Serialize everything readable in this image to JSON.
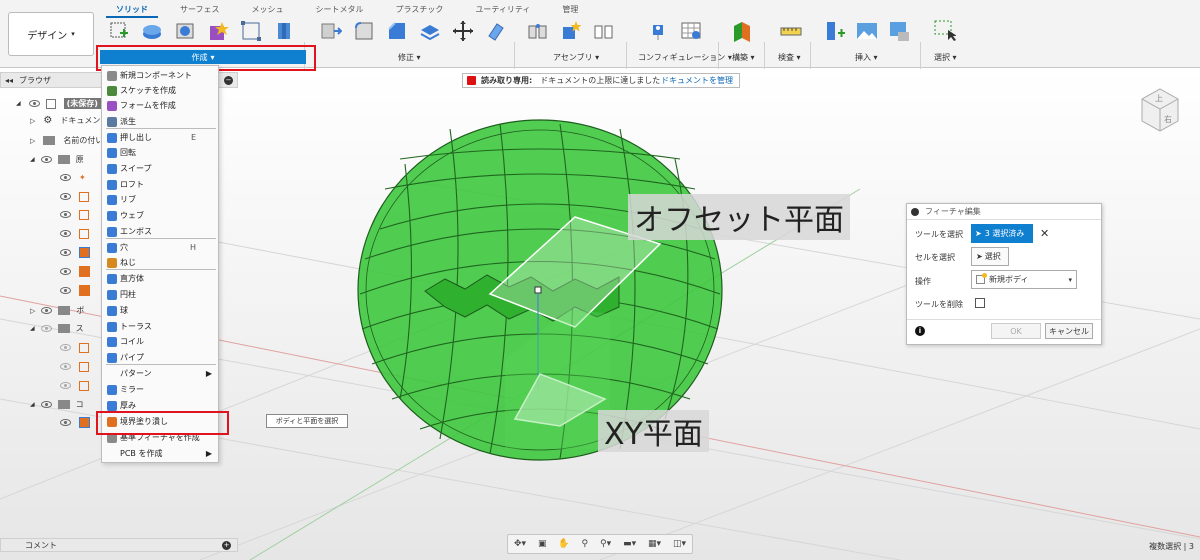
{
  "toolbar": {
    "design_label": "デザイン",
    "tabs": [
      "ソリッド",
      "サーフェス",
      "メッシュ",
      "シートメタル",
      "プラスチック",
      "ユーティリティ",
      "管理"
    ],
    "groups": {
      "create": "作成",
      "modify": "修正",
      "assemble": "アセンブリ",
      "configure": "コンフィギュレーション",
      "construct": "構築",
      "inspect": "検査",
      "insert": "挿入",
      "select": "選択"
    }
  },
  "browser": {
    "title": "ブラウザ",
    "items": [
      "(未保存)",
      "ドキュメントの設定",
      "名前の付いたビュー",
      "原",
      "ボ",
      "ス",
      "コ"
    ]
  },
  "readonly": {
    "label": "読み取り専用:",
    "message": "ドキュメントの上限に達しました",
    "manage_link": "ドキュメントを管理"
  },
  "create_menu": {
    "items": [
      {
        "label": "新規コンポーネント",
        "shortcut": "",
        "color": "#8a8a8a"
      },
      {
        "label": "スケッチを作成",
        "shortcut": "",
        "color": "#4a8a3a"
      },
      {
        "label": "フォームを作成",
        "shortcut": "",
        "color": "#9a4fc0"
      },
      {
        "label": "派生",
        "shortcut": "",
        "color": "#5a7aa0"
      },
      {
        "label": "押し出し",
        "shortcut": "E",
        "color": "#3a7bd5"
      },
      {
        "label": "回転",
        "shortcut": "",
        "color": "#3a7bd5"
      },
      {
        "label": "スイープ",
        "shortcut": "",
        "color": "#3a7bd5"
      },
      {
        "label": "ロフト",
        "shortcut": "",
        "color": "#3a7bd5"
      },
      {
        "label": "リブ",
        "shortcut": "",
        "color": "#3a7bd5"
      },
      {
        "label": "ウェブ",
        "shortcut": "",
        "color": "#3a7bd5"
      },
      {
        "label": "エンボス",
        "shortcut": "",
        "color": "#3a7bd5"
      },
      {
        "label": "穴",
        "shortcut": "H",
        "color": "#3a7bd5"
      },
      {
        "label": "ねじ",
        "shortcut": "",
        "color": "#d68a1e"
      },
      {
        "label": "直方体",
        "shortcut": "",
        "color": "#3a7bd5"
      },
      {
        "label": "円柱",
        "shortcut": "",
        "color": "#3a7bd5"
      },
      {
        "label": "球",
        "shortcut": "",
        "color": "#3a7bd5"
      },
      {
        "label": "トーラス",
        "shortcut": "",
        "color": "#3a7bd5"
      },
      {
        "label": "コイル",
        "shortcut": "",
        "color": "#3a7bd5"
      },
      {
        "label": "パイプ",
        "shortcut": "",
        "color": "#3a7bd5"
      },
      {
        "label": "パターン",
        "shortcut": "",
        "color": ""
      },
      {
        "label": "ミラー",
        "shortcut": "",
        "color": "#3a7bd5"
      },
      {
        "label": "厚み",
        "shortcut": "",
        "color": "#3a7bd5"
      },
      {
        "label": "境界塗り潰し",
        "shortcut": "",
        "color": "#e07020"
      },
      {
        "label": "基準フィーチャを作成",
        "shortcut": "",
        "color": "#8a8a8a"
      },
      {
        "label": "PCB を作成",
        "shortcut": "",
        "color": ""
      }
    ]
  },
  "tooltip": "ボディと平面を選択",
  "viewport": {
    "offset_plane_label": "オフセット平面",
    "xy_plane_label": "XY平面"
  },
  "feature_panel": {
    "title": "フィーチャ編集",
    "tool_label": "ツールを選択",
    "tool_value": "3 選択済み",
    "cell_label": "セルを選択",
    "cell_button": "選択",
    "operation_label": "操作",
    "operation_value": "新規ボディ",
    "remove_tool_label": "ツールを削除",
    "ok_label": "OK",
    "cancel_label": "キャンセル"
  },
  "comments": {
    "label": "コメント"
  },
  "status": {
    "text": "複数選択 | 3"
  },
  "colors": {
    "accent": "#0f7fd0",
    "highlight_red": "#e0141e",
    "body_green": "#39c639"
  }
}
